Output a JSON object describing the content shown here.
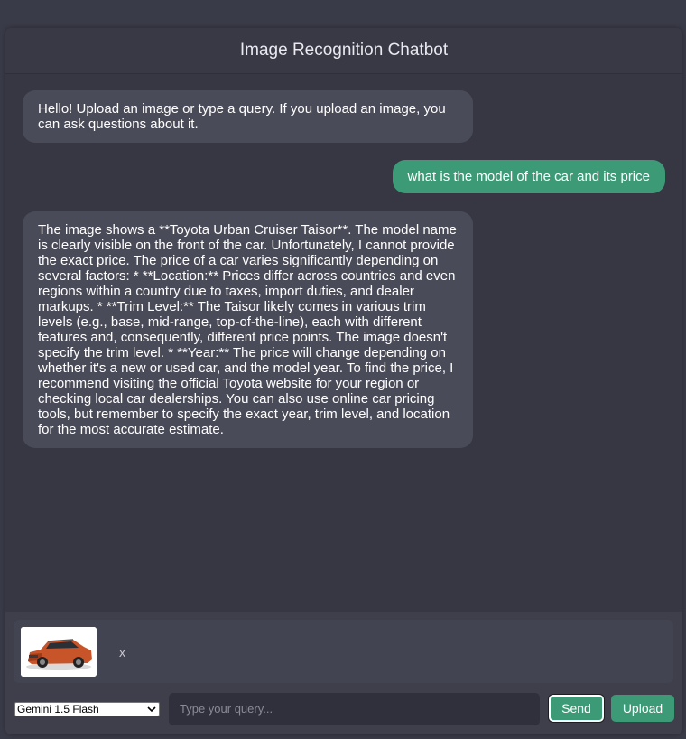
{
  "app": {
    "title": "Image Recognition Chatbot"
  },
  "messages": [
    {
      "role": "bot",
      "text": "Hello! Upload an image or type a query. If you upload an image, you can ask questions about it."
    },
    {
      "role": "user",
      "text": "what is the model of the car and its price"
    },
    {
      "role": "bot",
      "text": "The image shows a **Toyota Urban Cruiser Taisor**. The model name is clearly visible on the front of the car. Unfortunately, I cannot provide the exact price. The price of a car varies significantly depending on several factors: * **Location:** Prices differ across countries and even regions within a country due to taxes, import duties, and dealer markups. * **Trim Level:** The Taisor likely comes in various trim levels (e.g., base, mid-range, top-of-the-line), each with different features and, consequently, different price points. The image doesn't specify the trim level. * **Year:** The price will change depending on whether it's a new or used car, and the model year. To find the price, I recommend visiting the official Toyota website for your region or checking local car dealerships. You can also use online car pricing tools, but remember to specify the exact year, trim level, and location for the most accurate estimate."
    }
  ],
  "composer": {
    "preview": {
      "image_icon": "orange-suv-thumbnail",
      "remove_label": "x"
    },
    "model_select": {
      "selected": "Gemini 1.5 Flash"
    },
    "query_input": {
      "placeholder": "Type your query..."
    },
    "send_label": "Send",
    "upload_label": "Upload"
  },
  "colors": {
    "background": "#3a3b48",
    "bot_bubble": "#4a4b58",
    "user_bubble": "#3d9a77",
    "accent": "#3d9a77",
    "input_bg": "#2f303b"
  }
}
